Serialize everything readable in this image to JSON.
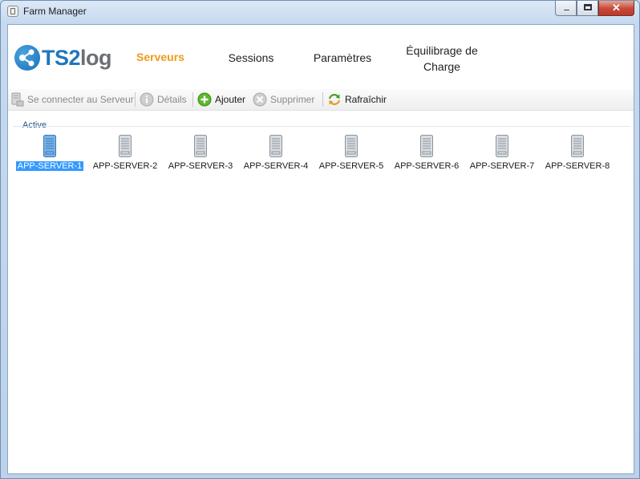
{
  "window": {
    "title": "Farm Manager",
    "close_glyph": "✕"
  },
  "logo": {
    "text_ts": "TS2",
    "text_log": "log"
  },
  "nav": {
    "items": [
      {
        "key": "servers",
        "label": "Serveurs",
        "active": true
      },
      {
        "key": "sessions",
        "label": "Sessions",
        "active": false
      },
      {
        "key": "settings",
        "label": "Paramètres",
        "active": false
      },
      {
        "key": "loadbalancing",
        "label_line1": "Équilibrage de",
        "label_line2": "Charge",
        "active": false
      }
    ]
  },
  "toolbar": {
    "connect_label": "Se connecter au Serveur",
    "details_label": "Détails",
    "add_label": "Ajouter",
    "remove_label": "Supprimer",
    "refresh_label": "Rafraîchir"
  },
  "group": {
    "label": "Active"
  },
  "servers": [
    {
      "name": "APP-SERVER-1",
      "selected": true
    },
    {
      "name": "APP-SERVER-2",
      "selected": false
    },
    {
      "name": "APP-SERVER-3",
      "selected": false
    },
    {
      "name": "APP-SERVER-4",
      "selected": false
    },
    {
      "name": "APP-SERVER-5",
      "selected": false
    },
    {
      "name": "APP-SERVER-6",
      "selected": false
    },
    {
      "name": "APP-SERVER-7",
      "selected": false
    },
    {
      "name": "APP-SERVER-8",
      "selected": false
    }
  ],
  "colors": {
    "accent_active_tab": "#f09a1a",
    "logo_blue": "#2076bc",
    "logo_gray": "#6c6f73",
    "selection": "#3399ff",
    "group_label": "#1f4f8b"
  }
}
